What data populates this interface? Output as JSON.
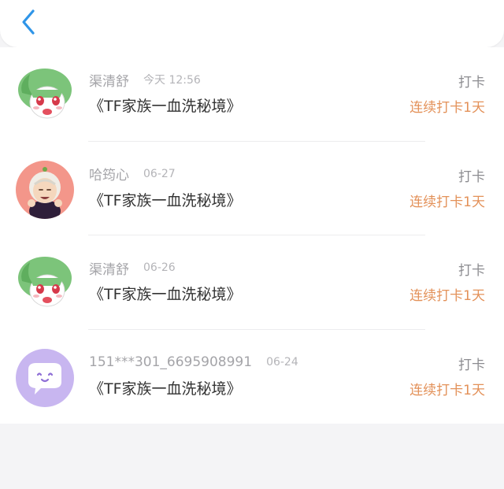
{
  "header": {
    "back_icon": "chevron-left-icon",
    "accent_color": "#2f95e8"
  },
  "entries": [
    {
      "name": "渠清舒",
      "time": "今天 12:56",
      "book": "《TF家族一血洗秘境》",
      "action": "打卡",
      "streak": "连续打卡1天",
      "avatar_icon": "green-hair-character-icon"
    },
    {
      "name": "哈筠心",
      "time": "06-27",
      "book": "《TF家族一血洗秘境》",
      "action": "打卡",
      "streak": "连续打卡1天",
      "avatar_icon": "grandma-character-icon"
    },
    {
      "name": "渠清舒",
      "time": "06-26",
      "book": "《TF家族一血洗秘境》",
      "action": "打卡",
      "streak": "连续打卡1天",
      "avatar_icon": "green-hair-character-icon"
    },
    {
      "name": "151***301_6695908991",
      "time": "06-24",
      "book": "《TF家族一血洗秘境》",
      "action": "打卡",
      "streak": "连续打卡1天",
      "avatar_icon": "chat-bubble-icon"
    }
  ],
  "colors": {
    "streak": "#e39159",
    "avatar_purple": "#c8b6f0",
    "avatar_pink": "#f3968a"
  }
}
